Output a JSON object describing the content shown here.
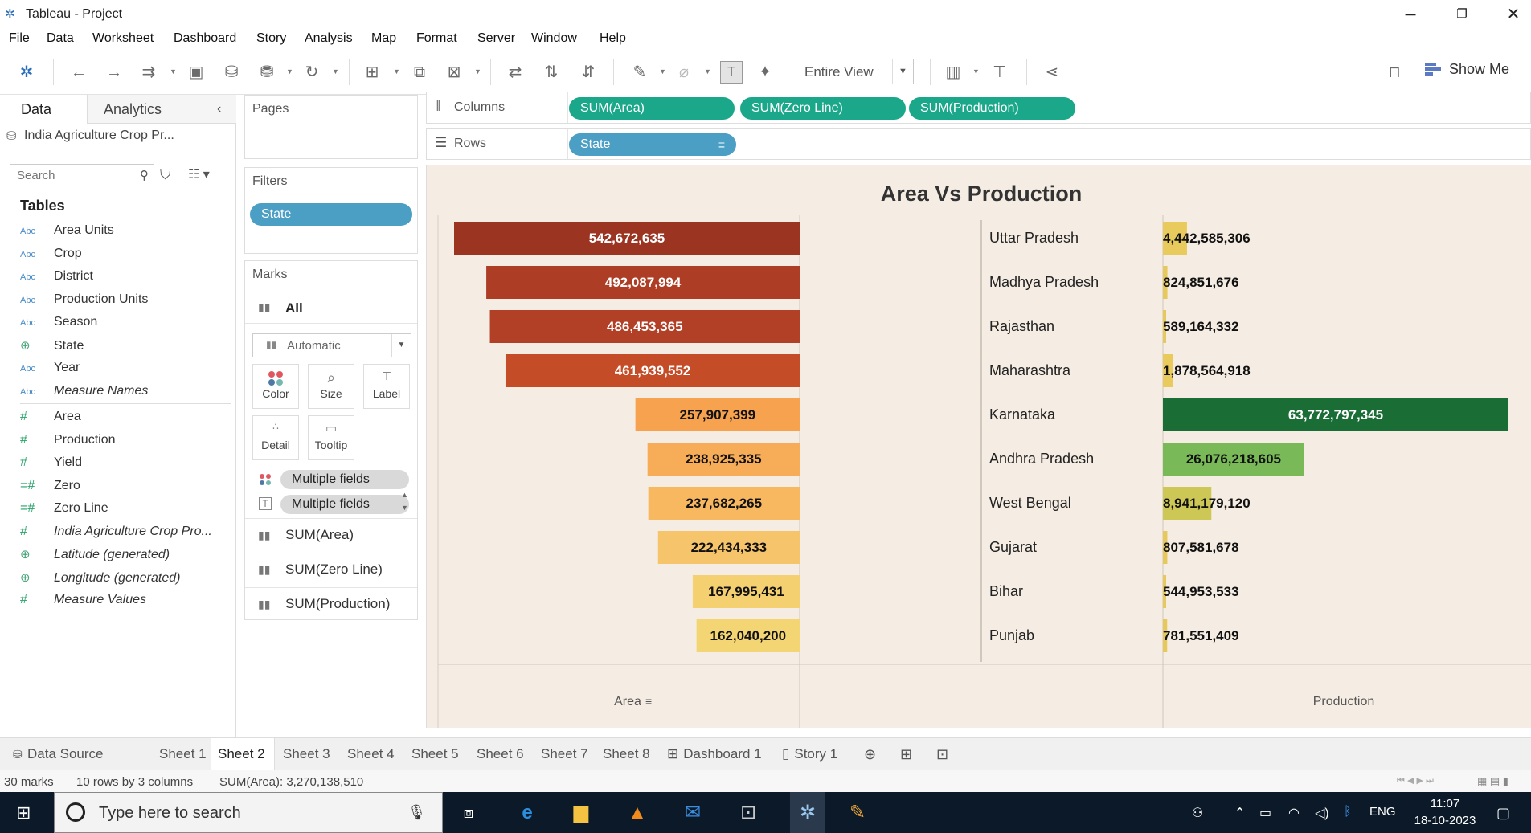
{
  "window": {
    "title": "Tableau - Project"
  },
  "menu": [
    "File",
    "Data",
    "Worksheet",
    "Dashboard",
    "Story",
    "Analysis",
    "Map",
    "Format",
    "Server",
    "Window",
    "Help"
  ],
  "toolbar": {
    "fit": "Entire View",
    "show_me": "Show Me"
  },
  "datapane": {
    "tab_data": "Data",
    "tab_analytics": "Analytics",
    "datasource": "India Agriculture Crop Pr...",
    "search_placeholder": "Search",
    "tables_label": "Tables",
    "dimensions": [
      {
        "type": "Abc",
        "name": "Area Units"
      },
      {
        "type": "Abc",
        "name": "Crop"
      },
      {
        "type": "Abc",
        "name": "District"
      },
      {
        "type": "Abc",
        "name": "Production Units"
      },
      {
        "type": "Abc",
        "name": "Season"
      },
      {
        "type": "globe",
        "name": "State"
      },
      {
        "type": "Abc",
        "name": "Year"
      },
      {
        "type": "Abc",
        "name": "Measure Names",
        "italic": true
      }
    ],
    "measures": [
      {
        "type": "#",
        "name": "Area"
      },
      {
        "type": "#",
        "name": "Production"
      },
      {
        "type": "#",
        "name": "Yield"
      },
      {
        "type": "=#",
        "name": "Zero"
      },
      {
        "type": "=#",
        "name": "Zero Line"
      },
      {
        "type": "#",
        "name": "India Agriculture Crop Pro...",
        "italic": true
      },
      {
        "type": "globe",
        "name": "Latitude (generated)",
        "italic": true
      },
      {
        "type": "globe",
        "name": "Longitude (generated)",
        "italic": true
      },
      {
        "type": "#",
        "name": "Measure Values",
        "italic": true
      }
    ]
  },
  "cards": {
    "pages": "Pages",
    "filters": "Filters",
    "filter_pill": "State",
    "marks": "Marks",
    "marks_all": "All",
    "mark_type": "Automatic",
    "buttons": [
      "Color",
      "Size",
      "Label",
      "Detail",
      "Tooltip"
    ],
    "multi_pill_1": "Multiple fields",
    "multi_pill_2": "Multiple fields",
    "measure_rows": [
      "SUM(Area)",
      "SUM(Zero Line)",
      "SUM(Production)"
    ]
  },
  "shelves": {
    "columns_label": "Columns",
    "rows_label": "Rows",
    "columns": [
      "SUM(Area)",
      "SUM(Zero Line)",
      "SUM(Production)"
    ],
    "rows": [
      "State"
    ]
  },
  "chart_data": {
    "type": "bar",
    "title": "Area Vs Production",
    "categories": [
      "Uttar Pradesh",
      "Madhya Pradesh",
      "Rajasthan",
      "Maharashtra",
      "Karnataka",
      "Andhra Pradesh",
      "West Bengal",
      "Gujarat",
      "Bihar",
      "Punjab"
    ],
    "series": [
      {
        "name": "Area",
        "values": [
          542672635,
          492087994,
          486453365,
          461939552,
          257907399,
          238925335,
          237682265,
          222434333,
          167995431,
          162040200
        ],
        "labels": [
          "542,672,635",
          "492,087,994",
          "486,453,365",
          "461,939,552",
          "257,907,399",
          "238,925,335",
          "237,682,265",
          "222,434,333",
          "167,995,431",
          "162,040,200"
        ],
        "colors": [
          "#9c3422",
          "#ad3d24",
          "#b14026",
          "#c44c27",
          "#f6a24f",
          "#f7ad57",
          "#f8b85f",
          "#f6c46a",
          "#f5d070",
          "#f3d574"
        ]
      },
      {
        "name": "Production",
        "values": [
          4442585306,
          824851676,
          589164332,
          1878564918,
          63772797345,
          26076218605,
          8941179120,
          807581678,
          544953533,
          781551409
        ],
        "labels": [
          "4,442,585,306",
          "824,851,676",
          "589,164,332",
          "1,878,564,918",
          "63,772,797,345",
          "26,076,218,605",
          "8,941,179,120",
          "807,581,678",
          "544,953,533",
          "781,551,409"
        ],
        "colors": [
          "#e8cb5c",
          "#e6c95a",
          "#e6c95a",
          "#e8cb5c",
          "#1a6e35",
          "#79b957",
          "#cdc756",
          "#e6c95a",
          "#e6c95a",
          "#e6c95a"
        ]
      }
    ],
    "xlabel_left": "Area",
    "xlabel_right": "Production"
  },
  "sheet_tabs": [
    "Data Source",
    "Sheet 1",
    "Sheet 2",
    "Sheet 3",
    "Sheet 4",
    "Sheet 5",
    "Sheet 6",
    "Sheet 7",
    "Sheet 8",
    "Dashboard 1",
    "Story 1"
  ],
  "active_tab": "Sheet 2",
  "status": {
    "marks": "30 marks",
    "dims": "10 rows by 3 columns",
    "sum": "SUM(Area): 3,270,138,510"
  },
  "taskbar": {
    "search_placeholder": "Type here to search",
    "lang": "ENG",
    "time": "11:07",
    "date": "18-10-2023"
  }
}
